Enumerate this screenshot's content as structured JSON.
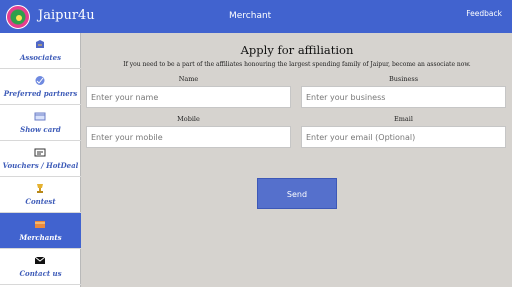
{
  "header": {
    "app_title": "Jaipur4u",
    "screen_title": "Merchant",
    "feedback": "Feedback"
  },
  "sidebar": {
    "items": [
      {
        "label": "Associates",
        "icon": "associates-icon"
      },
      {
        "label": "Preferred partners",
        "icon": "preferred-partners-icon"
      },
      {
        "label": "Show card",
        "icon": "show-card-icon"
      },
      {
        "label": "Vouchers / HotDeal",
        "icon": "voucher-icon"
      },
      {
        "label": "Contest",
        "icon": "trophy-icon"
      },
      {
        "label": "Merchants",
        "icon": "merchant-icon"
      },
      {
        "label": "Contact us",
        "icon": "mail-icon"
      }
    ]
  },
  "form": {
    "title": "Apply for affiliation",
    "subtitle": "If you need to be a part of the affiliates honouring the largest spending family of Jaipur, become an associate now.",
    "name_label": "Name",
    "name_placeholder": "Enter your name",
    "business_label": "Business",
    "business_placeholder": "Enter your business",
    "mobile_label": "Mobile",
    "mobile_placeholder": "Enter your mobile",
    "email_label": "Email",
    "email_placeholder": "Enter your email (Optional)",
    "send_label": "Send"
  },
  "colors": {
    "accent": "#4163cf",
    "background": "#d6d3cf",
    "sidebar_text": "#3d5bb8"
  }
}
